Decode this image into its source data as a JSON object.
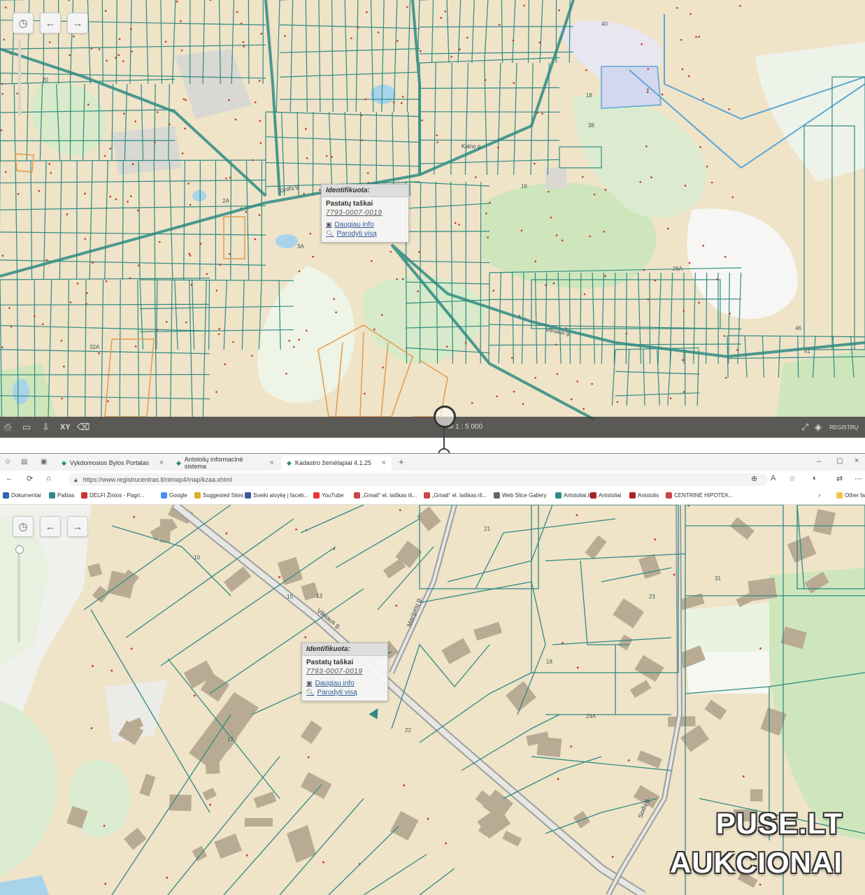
{
  "top_map": {
    "popup": {
      "header": "Identifikuota:",
      "title": "Pastatų taškai",
      "id": "7793-0007-0019",
      "more_info": "Daugiau info",
      "show_all": "Parodyti visą"
    },
    "scale": "M 1 : 5 000",
    "xy_label": "XY",
    "brand": "REGISTRŲ",
    "street_labels": [
      "Grafų g.",
      "Kalno g.",
      "Vilniaus g."
    ],
    "parcel_numbers": [
      "2A",
      "3A",
      "26A",
      "32A",
      "18",
      "16",
      "38",
      "40",
      "46",
      "41",
      "20"
    ]
  },
  "browser": {
    "tabs": [
      {
        "label": "Vykdomosios Bylos Portalas",
        "active": false
      },
      {
        "label": "Antstolių informacinė sistema",
        "active": false
      },
      {
        "label": "Kadastro žemėlapiai 4.1.25",
        "active": true
      }
    ],
    "url": "https://www.registrucentras.lt/ntmap4/map/kzaa.xhtml",
    "bookmarks": [
      "Dokumentai",
      "Paštas",
      "DELFI Žinios - Pagri...",
      "Google",
      "Suggested Sites",
      "Sveiki atvykę į faceb...",
      "YouTube",
      "„Gmail“ el. laiškas iš...",
      "„Gmail“ el. laiškas iš...",
      "Web Slice Gallery",
      "Antstoliai.lt",
      "Antstoliai",
      "Antstolis",
      "CENTRINĖ HIPOTEK...",
      "Other favorites"
    ]
  },
  "bottom_map": {
    "popup": {
      "header": "Identifikuota:",
      "title": "Pastatų taškai",
      "id": "7793-0007-0019",
      "more_info": "Daugiau info",
      "show_all": "Parodyti visą"
    },
    "street_labels": [
      "Vilniaus g.",
      "Marijonų g.",
      "Sodų g."
    ],
    "parcel_numbers": [
      "10",
      "15",
      "13",
      "21",
      "22",
      "17",
      "18",
      "23",
      "24A",
      "31"
    ]
  },
  "watermark": {
    "line1": "PUSE.LT",
    "line2": "AUKCIONAI"
  },
  "colors": {
    "parcel_line": "#2e8b83",
    "road": "#9aa09f",
    "land": "#efe3c8",
    "green": "#cfe6bd",
    "water": "#a9d3ea",
    "building": "#b9ab93",
    "orange": "#e39b4a"
  }
}
